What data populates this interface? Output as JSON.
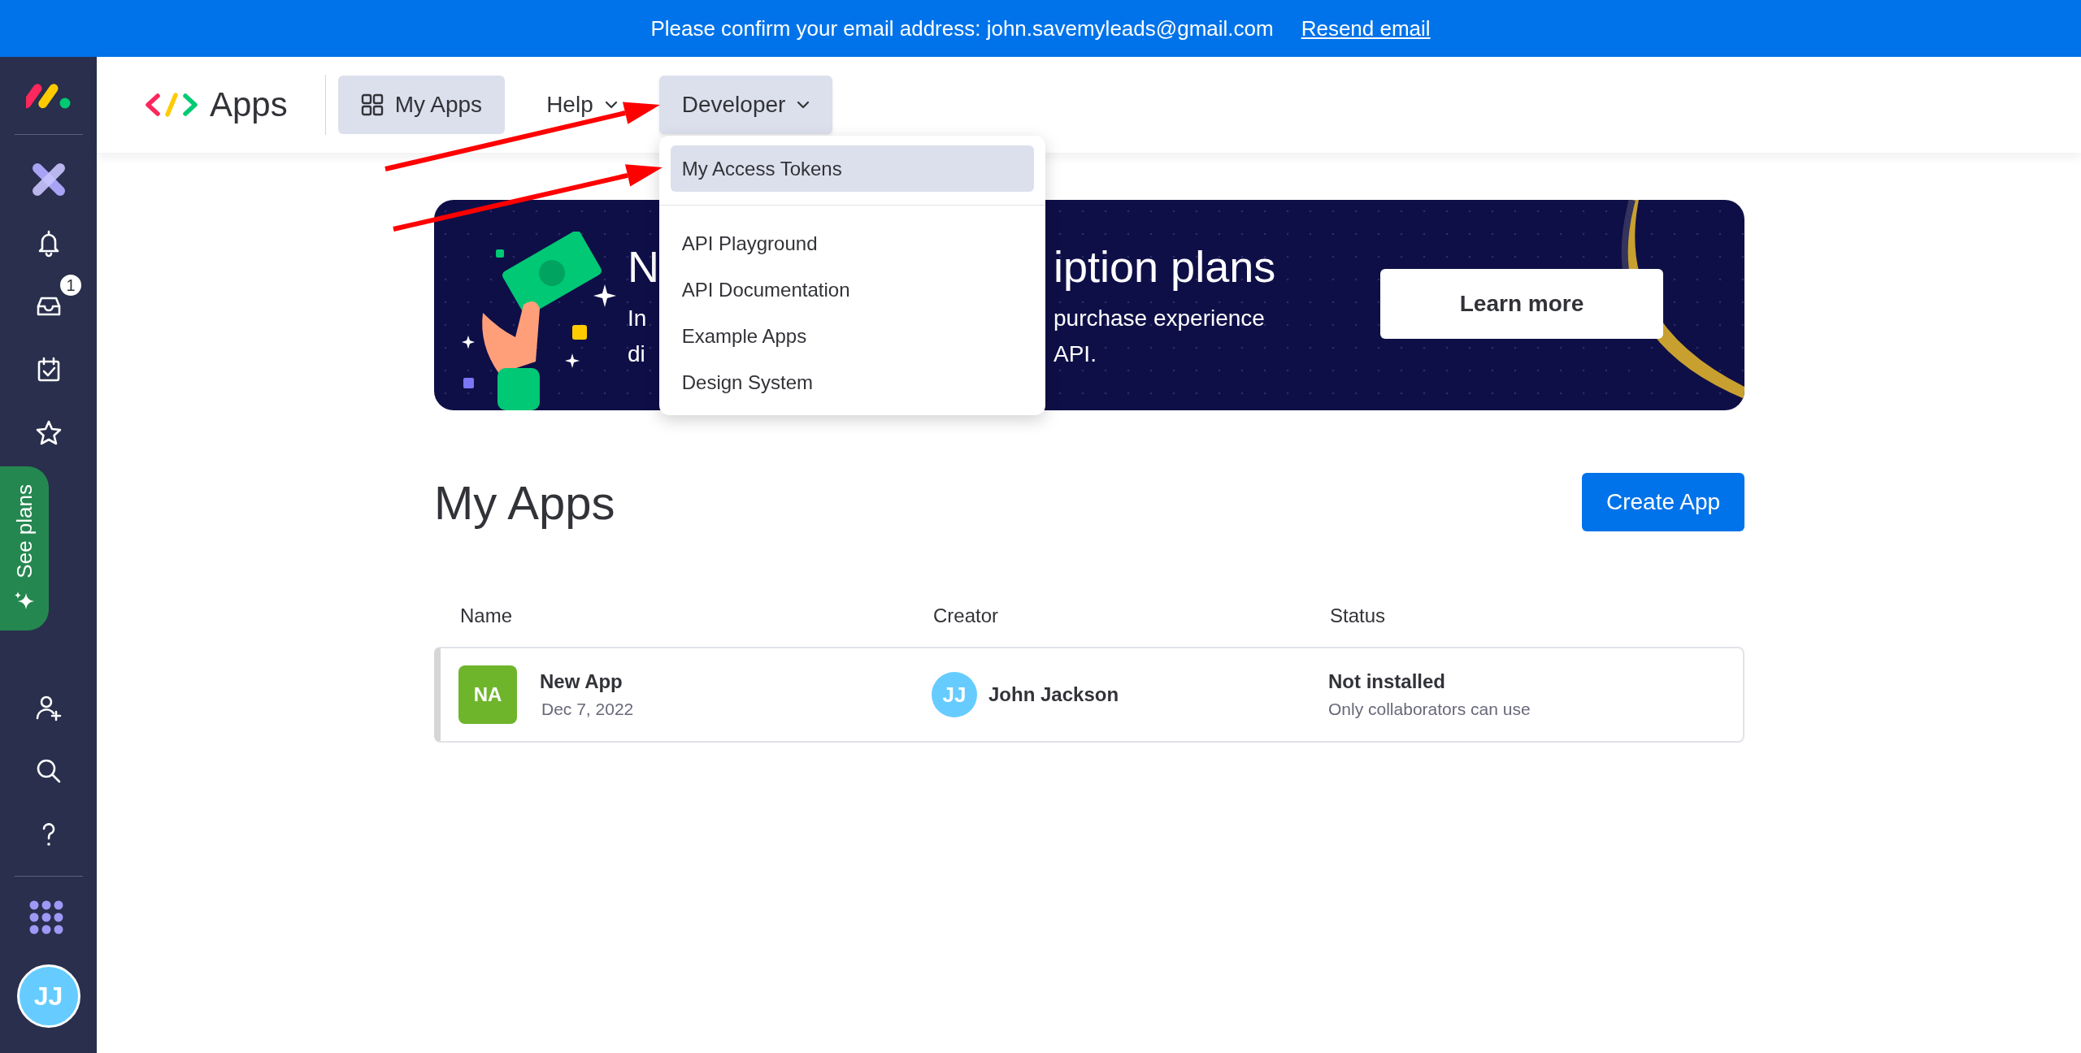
{
  "notice": {
    "text": "Please confirm your email address: john.savemyleads@gmail.com",
    "link": "Resend email"
  },
  "sidebar": {
    "inbox_badge": "1",
    "promo": "See plans",
    "avatar": "JJ"
  },
  "header": {
    "title": "Apps",
    "nav": [
      {
        "label": "My Apps",
        "kind": "link",
        "selected": true,
        "expanded": false
      },
      {
        "label": "Help",
        "kind": "menu",
        "selected": false,
        "expanded": false
      },
      {
        "label": "Developer",
        "kind": "menu",
        "selected": true,
        "expanded": true
      }
    ]
  },
  "dropdown": {
    "sections": [
      {
        "items": [
          {
            "label": "My Access Tokens",
            "selected": true
          }
        ]
      },
      {
        "items": [
          {
            "label": "API Playground",
            "selected": false
          },
          {
            "label": "API Documentation",
            "selected": false
          },
          {
            "label": "Example Apps",
            "selected": false
          },
          {
            "label": "Design System",
            "selected": false
          }
        ]
      }
    ]
  },
  "banner": {
    "lines": [
      {
        "kind": "title",
        "parts": [
          "N",
          "iption plans"
        ]
      },
      {
        "kind": "text",
        "parts": [
          "In",
          "purchase experience"
        ]
      },
      {
        "kind": "text",
        "parts": [
          "di",
          "API."
        ]
      }
    ],
    "button": "Learn more"
  },
  "apps": {
    "title": "My Apps",
    "create_button": "Create App",
    "columns": [
      "Name",
      "Creator",
      "Status"
    ],
    "rows": [
      {
        "initials": "NA",
        "name": "New App",
        "date": "Dec 7, 2022",
        "creator_initials": "JJ",
        "creator": "John Jackson",
        "status": "Not installed",
        "status_note": "Only collaborators can use"
      }
    ]
  }
}
